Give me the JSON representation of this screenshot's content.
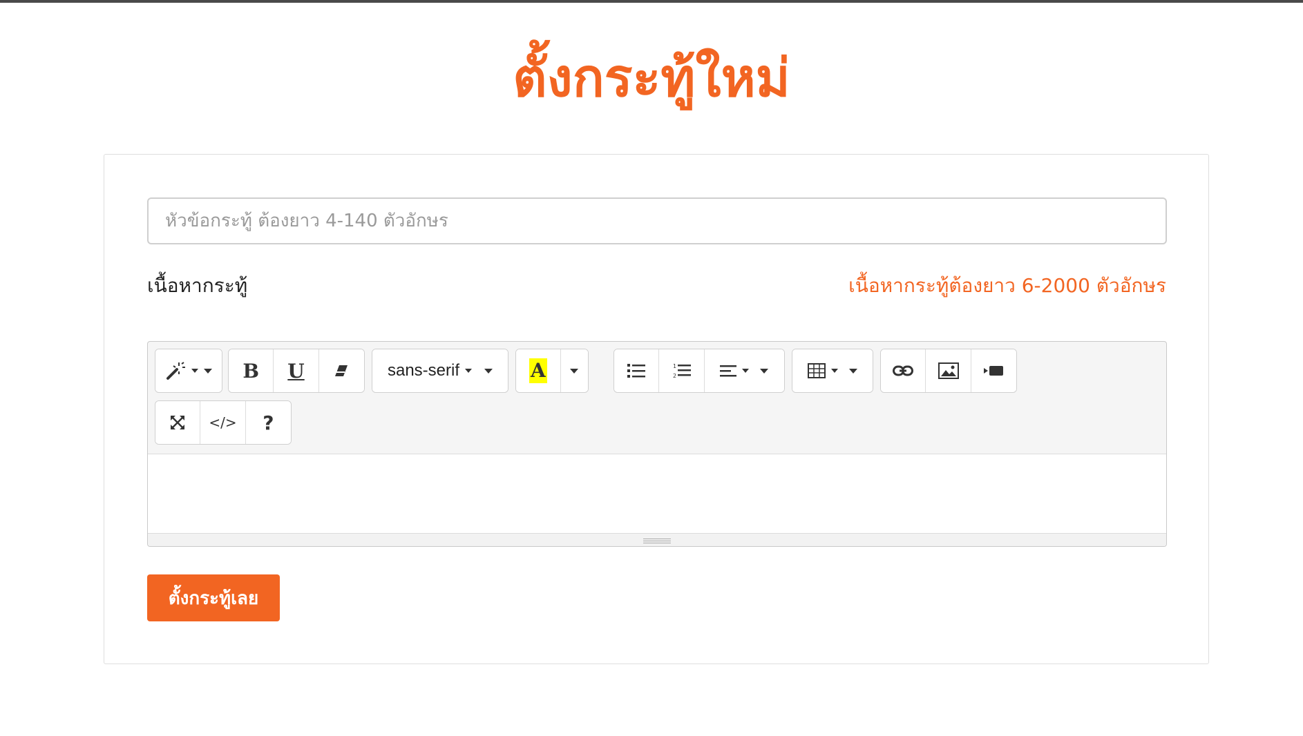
{
  "page": {
    "title": "ตั้งกระทู้ใหม่",
    "accent_color": "#f26522"
  },
  "form": {
    "title_placeholder": "หัวข้อกระทู้ ต้องยาว 4-140 ตัวอักษร",
    "title_value": "",
    "content_label": "เนื้อหากระทู้",
    "content_hint": "เนื้อหากระทู้ต้องยาว 6-2000 ตัวอักษร",
    "submit_label": "ตั้งกระทู้เลย"
  },
  "editor": {
    "font_name": "sans-serif",
    "highlight_color": "#ffff00",
    "toolbar_icons": [
      "magic-style-icon",
      "bold-icon",
      "underline-icon",
      "eraser-icon",
      "font-name-dropdown",
      "color-a-icon",
      "unordered-list-icon",
      "ordered-list-icon",
      "align-icon",
      "table-icon",
      "link-icon",
      "picture-icon",
      "video-icon",
      "fullscreen-icon",
      "code-view-icon",
      "help-icon"
    ],
    "bold_glyph": "B",
    "underline_glyph": "U",
    "color_glyph": "A",
    "code_glyph": "</>",
    "help_glyph": "?"
  }
}
